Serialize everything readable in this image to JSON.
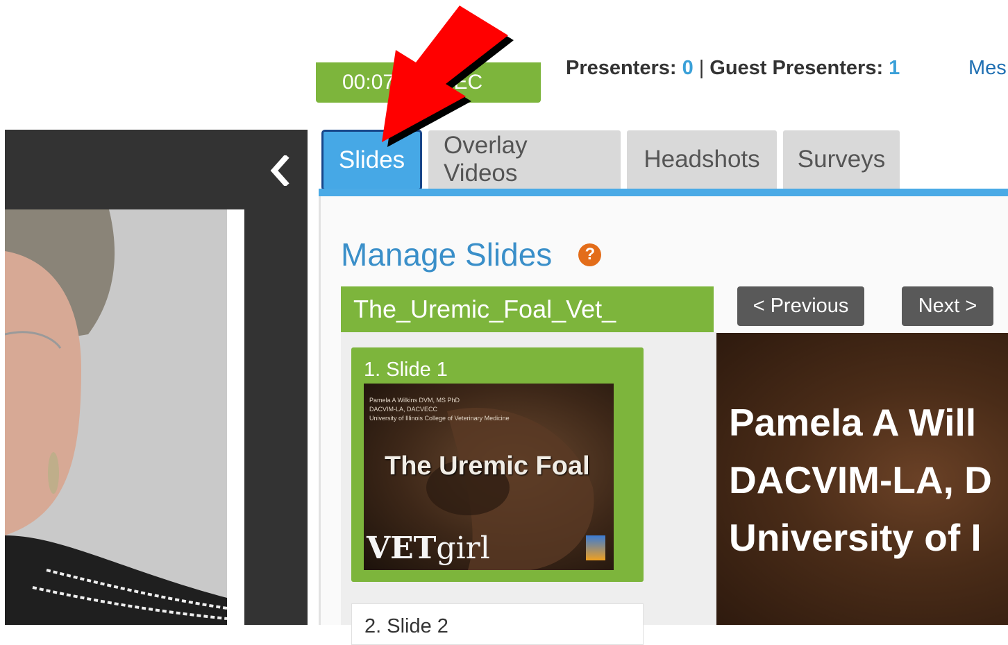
{
  "timer": {
    "time": "00:07:31",
    "rec_label": "REC"
  },
  "presenters": {
    "presenters_label": "Presenters:",
    "presenters_count": "0",
    "separator": "|",
    "guest_label": "Guest Presenters:",
    "guest_count": "1"
  },
  "messages_link": "Mes",
  "tabs": [
    {
      "label": "Slides",
      "active": true
    },
    {
      "label": "Overlay Videos"
    },
    {
      "label": "Headshots"
    },
    {
      "label": "Surveys"
    }
  ],
  "manage": {
    "title": "Manage Slides",
    "help": "?"
  },
  "deck": {
    "name": "The_Uremic_Foal_Vet_"
  },
  "slides": [
    {
      "label": "1. Slide 1",
      "thumb": {
        "credit_lines": [
          "Pamela A Wilkins DVM, MS PhD",
          "DACVIM-LA, DACVECC",
          "University of Illinois College of Veterinary Medicine"
        ],
        "title": "The Uremic Foal",
        "brand_bold": "VET",
        "brand_rest": "girl"
      }
    },
    {
      "label": "2. Slide 2"
    }
  ],
  "nav": {
    "previous": "< Previous",
    "next": "Next >"
  },
  "preview": {
    "lines": [
      "Pamela A Will",
      "DACVIM-LA, D",
      "University of I"
    ]
  },
  "colors": {
    "green": "#7db53c",
    "blue_tab": "#46a8e6",
    "link_blue": "#3a8fc9",
    "annotation_red": "#ff0000"
  }
}
